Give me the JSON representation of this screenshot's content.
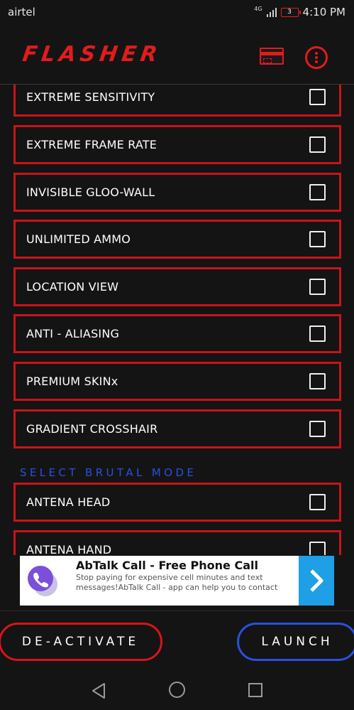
{
  "status_bar": {
    "carrier": "airtel",
    "network": "4G",
    "battery": "3",
    "time": "4:10 PM"
  },
  "header": {
    "brand": "FLASHER",
    "icons": [
      "card-icon",
      "more-vert-icon"
    ],
    "brand_color": "#e31b1b"
  },
  "options": [
    {
      "label": "EXTREME SENSITIVITY",
      "checked": false
    },
    {
      "label": "EXTREME FRAME RATE",
      "checked": false
    },
    {
      "label": "INVISIBLE GLOO-WALL",
      "checked": false
    },
    {
      "label": "UNLIMITED AMMO",
      "checked": false
    },
    {
      "label": "LOCATION VIEW",
      "checked": false
    },
    {
      "label": "ANTI - ALIASING",
      "checked": false
    },
    {
      "label": "PREMIUM SKINx",
      "checked": false
    },
    {
      "label": "GRADIENT CROSSHAIR",
      "checked": false
    }
  ],
  "brutal_section": {
    "title": "SELECT BRUTAL MODE",
    "title_color": "#2b4fe0",
    "options": [
      {
        "label": "ANTENA HEAD",
        "checked": false
      },
      {
        "label": "ANTENA HAND",
        "checked": false
      }
    ]
  },
  "ad": {
    "title": "AbTalk Call - Free Phone Call",
    "description": "Stop paying for expensive cell minutes and text messages!AbTalk Call - app can help you to contact your...",
    "cta_icon": "chevron-right-icon",
    "cta_color": "#1e9fe6"
  },
  "buttons": {
    "deactivate": "DE-ACTIVATE",
    "launch": "LAUNCH",
    "deactivate_color": "#d8141a",
    "launch_color": "#2b4fe0"
  },
  "nav": {
    "icons": [
      "back-icon",
      "home-icon",
      "recents-icon"
    ]
  }
}
